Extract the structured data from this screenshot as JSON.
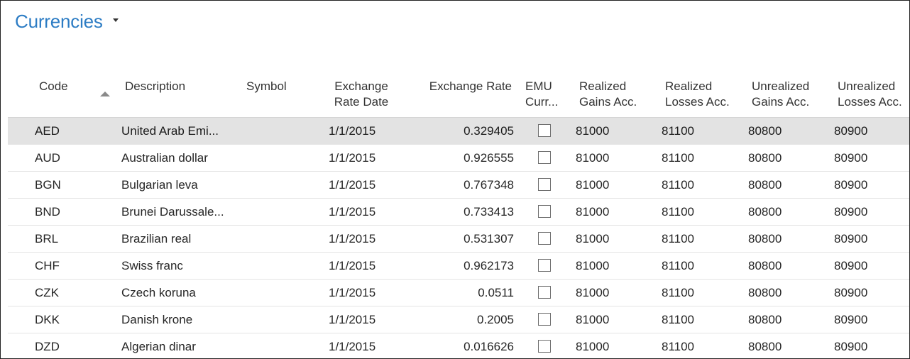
{
  "page": {
    "title": "Currencies"
  },
  "columns": {
    "code": "Code",
    "description": "Description",
    "symbol": "Symbol",
    "exchange_rate_date": [
      "Exchange",
      "Rate Date"
    ],
    "exchange_rate": "Exchange Rate",
    "emu_currency": [
      "EMU",
      "Curr..."
    ],
    "realized_gains": [
      "Realized",
      "Gains Acc."
    ],
    "realized_losses": [
      "Realized",
      "Losses Acc."
    ],
    "unrealized_gains": [
      "Unrealized",
      "Gains Acc."
    ],
    "unrealized_losses": [
      "Unrealized",
      "Losses Acc."
    ]
  },
  "rows": [
    {
      "code": "AED",
      "description": "United Arab Emi...",
      "symbol": "",
      "date": "1/1/2015",
      "rate": "0.329405",
      "emu": false,
      "rg": "81000",
      "rl": "81100",
      "ug": "80800",
      "ul": "80900",
      "selected": true
    },
    {
      "code": "AUD",
      "description": "Australian dollar",
      "symbol": "",
      "date": "1/1/2015",
      "rate": "0.926555",
      "emu": false,
      "rg": "81000",
      "rl": "81100",
      "ug": "80800",
      "ul": "80900",
      "selected": false
    },
    {
      "code": "BGN",
      "description": "Bulgarian leva",
      "symbol": "",
      "date": "1/1/2015",
      "rate": "0.767348",
      "emu": false,
      "rg": "81000",
      "rl": "81100",
      "ug": "80800",
      "ul": "80900",
      "selected": false
    },
    {
      "code": "BND",
      "description": "Brunei Darussale...",
      "symbol": "",
      "date": "1/1/2015",
      "rate": "0.733413",
      "emu": false,
      "rg": "81000",
      "rl": "81100",
      "ug": "80800",
      "ul": "80900",
      "selected": false
    },
    {
      "code": "BRL",
      "description": "Brazilian real",
      "symbol": "",
      "date": "1/1/2015",
      "rate": "0.531307",
      "emu": false,
      "rg": "81000",
      "rl": "81100",
      "ug": "80800",
      "ul": "80900",
      "selected": false
    },
    {
      "code": "CHF",
      "description": "Swiss franc",
      "symbol": "",
      "date": "1/1/2015",
      "rate": "0.962173",
      "emu": false,
      "rg": "81000",
      "rl": "81100",
      "ug": "80800",
      "ul": "80900",
      "selected": false
    },
    {
      "code": "CZK",
      "description": "Czech koruna",
      "symbol": "",
      "date": "1/1/2015",
      "rate": "0.0511",
      "emu": false,
      "rg": "81000",
      "rl": "81100",
      "ug": "80800",
      "ul": "80900",
      "selected": false
    },
    {
      "code": "DKK",
      "description": "Danish krone",
      "symbol": "",
      "date": "1/1/2015",
      "rate": "0.2005",
      "emu": false,
      "rg": "81000",
      "rl": "81100",
      "ug": "80800",
      "ul": "80900",
      "selected": false
    },
    {
      "code": "DZD",
      "description": "Algerian dinar",
      "symbol": "",
      "date": "1/1/2015",
      "rate": "0.016626",
      "emu": false,
      "rg": "81000",
      "rl": "81100",
      "ug": "80800",
      "ul": "80900",
      "selected": false
    }
  ],
  "colors": {
    "title": "#2c7cc4",
    "selected_row": "#e3e3e3",
    "border": "#222222"
  }
}
